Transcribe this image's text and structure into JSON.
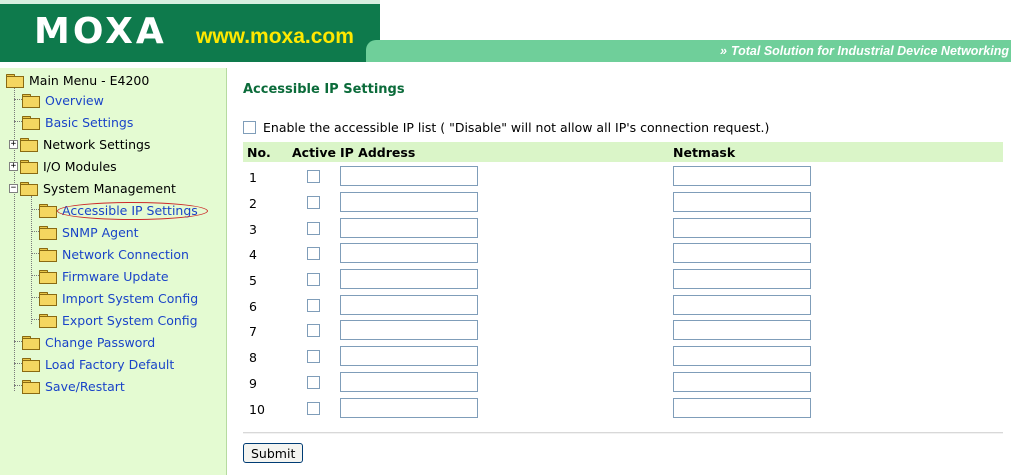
{
  "header": {
    "logo": "MOXA",
    "url": "www.moxa.com",
    "slogan_chevrons": "»",
    "slogan": "Total Solution for Industrial Device Networking"
  },
  "sidebar": {
    "root_label": "Main Menu - E4200",
    "items": [
      {
        "label": "Overview"
      },
      {
        "label": "Basic Settings"
      },
      {
        "label": "Network Settings"
      },
      {
        "label": "I/O Modules"
      },
      {
        "label": "System Management"
      },
      {
        "label": "Accessible IP Settings"
      },
      {
        "label": "SNMP Agent"
      },
      {
        "label": "Network Connection"
      },
      {
        "label": "Firmware Update"
      },
      {
        "label": "Import System Config"
      },
      {
        "label": "Export System Config"
      },
      {
        "label": "Change Password"
      },
      {
        "label": "Load Factory Default"
      },
      {
        "label": "Save/Restart"
      }
    ],
    "expander_plus": "+",
    "expander_minus": "−"
  },
  "main": {
    "title": "Accessible IP Settings",
    "enable_label": "Enable the accessible IP list ( \"Disable\" will not allow all IP's connection request.)",
    "enable_checked": false,
    "columns": {
      "no": "No.",
      "active": "Active",
      "ip": "IP Address",
      "netmask": "Netmask"
    },
    "rows": [
      {
        "no": "1",
        "active": false,
        "ip": "",
        "netmask": ""
      },
      {
        "no": "2",
        "active": false,
        "ip": "",
        "netmask": ""
      },
      {
        "no": "3",
        "active": false,
        "ip": "",
        "netmask": ""
      },
      {
        "no": "4",
        "active": false,
        "ip": "",
        "netmask": ""
      },
      {
        "no": "5",
        "active": false,
        "ip": "",
        "netmask": ""
      },
      {
        "no": "6",
        "active": false,
        "ip": "",
        "netmask": ""
      },
      {
        "no": "7",
        "active": false,
        "ip": "",
        "netmask": ""
      },
      {
        "no": "8",
        "active": false,
        "ip": "",
        "netmask": ""
      },
      {
        "no": "9",
        "active": false,
        "ip": "",
        "netmask": ""
      },
      {
        "no": "10",
        "active": false,
        "ip": "",
        "netmask": ""
      }
    ],
    "submit_label": "Submit"
  },
  "colors": {
    "brand_green": "#0e7a4c",
    "slogan_green": "#6fcf9a",
    "url_yellow": "#ffe800",
    "sidebar_bg": "#e4fbd2",
    "link_blue": "#1a44c8",
    "title_green": "#0b6b3a",
    "selection_ring": "#cc2b2b"
  }
}
